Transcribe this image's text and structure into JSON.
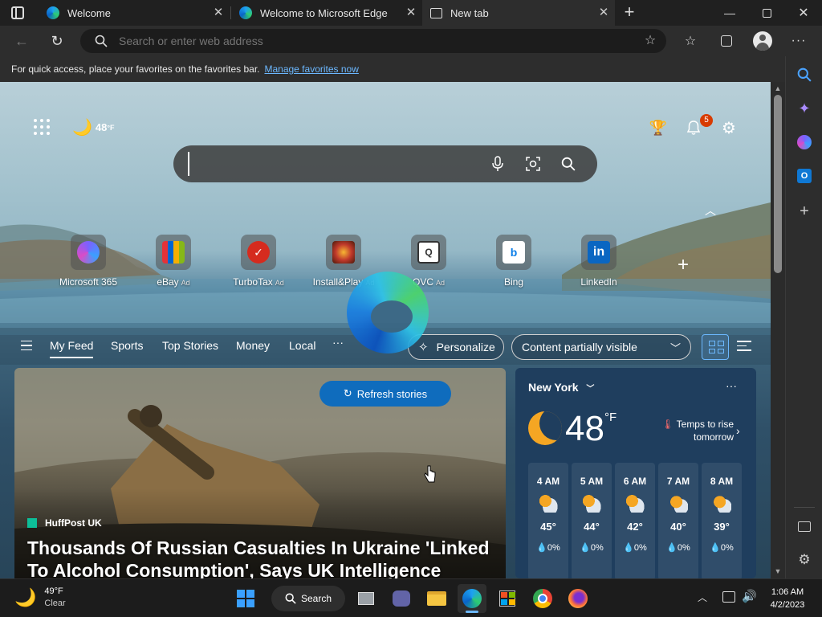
{
  "tabs": [
    {
      "title": "Welcome",
      "active": false
    },
    {
      "title": "Welcome to Microsoft Edge",
      "active": false
    },
    {
      "title": "New tab",
      "active": true
    }
  ],
  "address_bar": {
    "placeholder": "Search or enter web address"
  },
  "favorites_bar": {
    "message": "For quick access, place your favorites on the favorites bar.",
    "link": "Manage favorites now"
  },
  "newtab": {
    "weather_mini": {
      "temp": "48",
      "unit": "°F"
    },
    "notification_count": "5",
    "quick_links": [
      {
        "label": "Microsoft 365",
        "ad": ""
      },
      {
        "label": "eBay",
        "ad": "Ad"
      },
      {
        "label": "TurboTax",
        "ad": "Ad"
      },
      {
        "label": "Install&Play",
        "ad": "Ad"
      },
      {
        "label": "QVC",
        "ad": "Ad"
      },
      {
        "label": "Bing",
        "ad": ""
      },
      {
        "label": "LinkedIn",
        "ad": ""
      }
    ],
    "feed_tabs": [
      "My Feed",
      "Sports",
      "Top Stories",
      "Money",
      "Local"
    ],
    "more_tabs": "···",
    "personalize_label": "Personalize",
    "content_select": "Content partially visible",
    "refresh_label": "Refresh stories",
    "news": {
      "source": "HuffPost UK",
      "headline": "Thousands Of Russian Casualties In Ukraine 'Linked To Alcohol Consumption', Says UK Intelligence"
    },
    "weather_card": {
      "location": "New York",
      "temp": "48",
      "unit": "°F",
      "note": "Temps to rise tomorrow",
      "more": "···",
      "hours": [
        {
          "time": "4 AM",
          "temp": "45°",
          "precip": "0%"
        },
        {
          "time": "5 AM",
          "temp": "44°",
          "precip": "0%"
        },
        {
          "time": "6 AM",
          "temp": "42°",
          "precip": "0%"
        },
        {
          "time": "7 AM",
          "temp": "40°",
          "precip": "0%"
        },
        {
          "time": "8 AM",
          "temp": "39°",
          "precip": "0%"
        }
      ]
    }
  },
  "taskbar": {
    "weather_temp": "49°F",
    "weather_cond": "Clear",
    "search_label": "Search",
    "time": "1:06 AM",
    "date": "4/2/2023"
  },
  "colors": {
    "accent": "#0f6cbd",
    "badge": "#d83b01",
    "link": "#6cb8ff"
  }
}
